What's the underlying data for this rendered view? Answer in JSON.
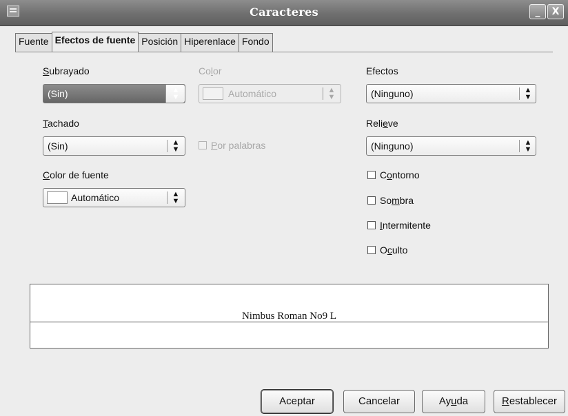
{
  "window": {
    "title": "Caracteres",
    "minimize_glyph": "_",
    "close_glyph": "X"
  },
  "tabs": [
    {
      "label": "Fuente",
      "active": false
    },
    {
      "label": "Efectos de fuente",
      "active": true
    },
    {
      "label": "Posición",
      "active": false
    },
    {
      "label": "Hiperenlace",
      "active": false
    },
    {
      "label": "Fondo",
      "active": false
    }
  ],
  "subrayado": {
    "label_u": "S",
    "label_rest": "ubrayado",
    "value": "(Sin)"
  },
  "color": {
    "label_pre": "Co",
    "label_u": "l",
    "label_rest": "or",
    "value": "Automático"
  },
  "efectos": {
    "label": "Efectos",
    "value": "(Ninguno)"
  },
  "tachado": {
    "label_u": "T",
    "label_rest": "achado",
    "value": "(Sin)"
  },
  "por_palabras": {
    "label_u": "P",
    "label_rest": "or palabras"
  },
  "relieve": {
    "label_pre": "Reli",
    "label_u": "e",
    "label_rest": "ve",
    "value": "(Ninguno)"
  },
  "color_fuente": {
    "label_u": "C",
    "label_rest": "olor de fuente",
    "value": "Automático"
  },
  "checkboxes": {
    "contorno": {
      "pre": "C",
      "u": "o",
      "rest": "ntorno"
    },
    "sombra": {
      "pre": "So",
      "u": "m",
      "rest": "bra"
    },
    "intermitente": {
      "pre": "",
      "u": "I",
      "rest": "ntermitente"
    },
    "oculto": {
      "pre": "O",
      "u": "c",
      "rest": "ulto"
    }
  },
  "preview": {
    "font_name": "Nimbus Roman No9 L"
  },
  "buttons": {
    "aceptar": "Aceptar",
    "cancelar": "Cancelar",
    "ayuda_pre": "Ay",
    "ayuda_u": "u",
    "ayuda_rest": "da",
    "restablecer_u": "R",
    "restablecer_rest": "establecer"
  },
  "icons": {
    "spin": "spin-arrows-icon",
    "window": "window-menu-icon"
  }
}
